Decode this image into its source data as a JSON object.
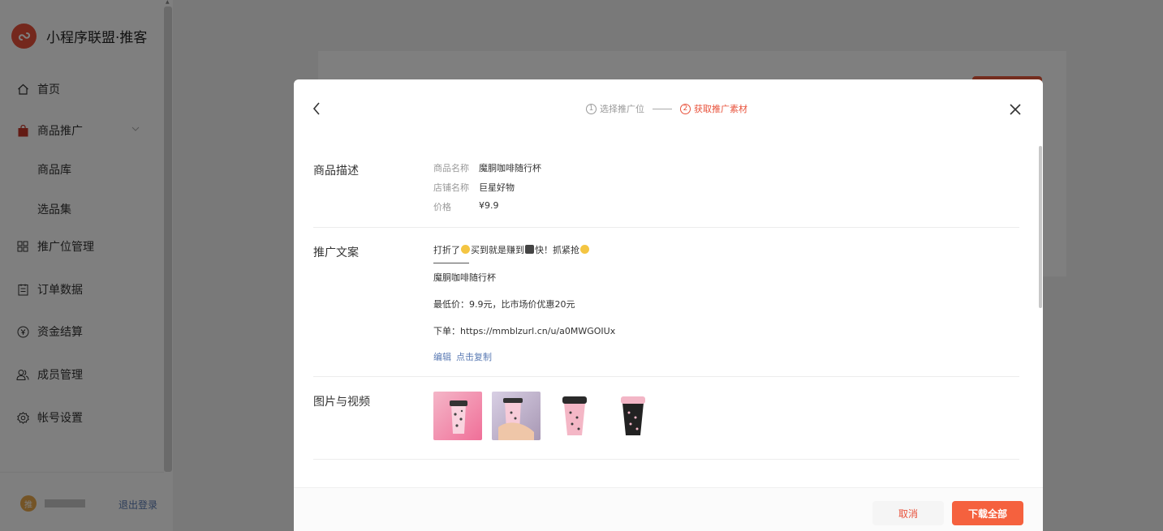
{
  "app": {
    "title": "小程序联盟·推客"
  },
  "sidebar": {
    "items": [
      {
        "label": "首页",
        "icon": "home-icon"
      },
      {
        "label": "商品推广",
        "icon": "bag-icon"
      },
      {
        "label": "推广位管理",
        "icon": "grid-icon"
      },
      {
        "label": "订单数据",
        "icon": "list-icon"
      },
      {
        "label": "资金结算",
        "icon": "yen-icon"
      },
      {
        "label": "成员管理",
        "icon": "users-icon"
      },
      {
        "label": "帐号设置",
        "icon": "gear-icon"
      }
    ],
    "subitems": [
      "商品库",
      "选品集"
    ],
    "user": {
      "avatar_text": "推"
    },
    "logout_label": "退出登录"
  },
  "modal": {
    "steps": [
      {
        "num": "1",
        "label": "选择推广位"
      },
      {
        "num": "2",
        "label": "获取推广素材"
      }
    ],
    "product": {
      "section_label": "商品描述",
      "name_key": "商品名称",
      "name_value": "魔胴咖啡随行杯",
      "shop_key": "店铺名称",
      "shop_value": "巨星好物",
      "price_key": "价格",
      "price_value": "¥9.9"
    },
    "copy": {
      "section_label": "推广文案",
      "line1_a": "打折了",
      "line1_b": "买到就是赚到",
      "line1_c": "快！抓紧抢",
      "line2": "魔胴咖啡随行杯",
      "line3": "最低价：9.9元，比市场价优惠20元",
      "line4": "下单：https://mmblzurl.cn/u/a0MWGOIUx",
      "edit_label": "编辑",
      "copy_label": "点击复制"
    },
    "media": {
      "section_label": "图片与视频"
    },
    "footer": {
      "cancel_label": "取消",
      "download_label": "下载全部"
    }
  },
  "colors": {
    "accent": "#f5613e",
    "link": "#5b7bb4",
    "brand": "#e8513a"
  }
}
